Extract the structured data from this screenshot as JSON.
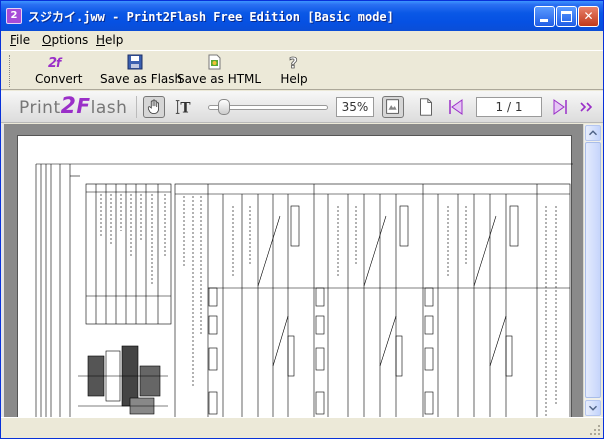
{
  "window": {
    "title": "スジカイ.jww - Print2Flash Free Edition [Basic mode]",
    "accent": "#0a58e6"
  },
  "menu": {
    "items": [
      {
        "label": "File",
        "mnemonic": "F",
        "rest": "ile"
      },
      {
        "label": "Options",
        "mnemonic": "O",
        "rest": "ptions"
      },
      {
        "label": "Help",
        "mnemonic": "H",
        "rest": "elp"
      }
    ]
  },
  "toolbar": {
    "convert_label": "Convert",
    "save_flash_label": "Save as Flash",
    "save_html_label": "Save as HTML",
    "help_label": "Help"
  },
  "viewer": {
    "logo_left": "Print",
    "logo_two": "2",
    "logo_right": "lash",
    "logo_f": "F",
    "zoom": "35%",
    "zoom_fraction": 0.35,
    "page_indicator": "1 / 1",
    "brand_color": "#9a2fc8"
  }
}
